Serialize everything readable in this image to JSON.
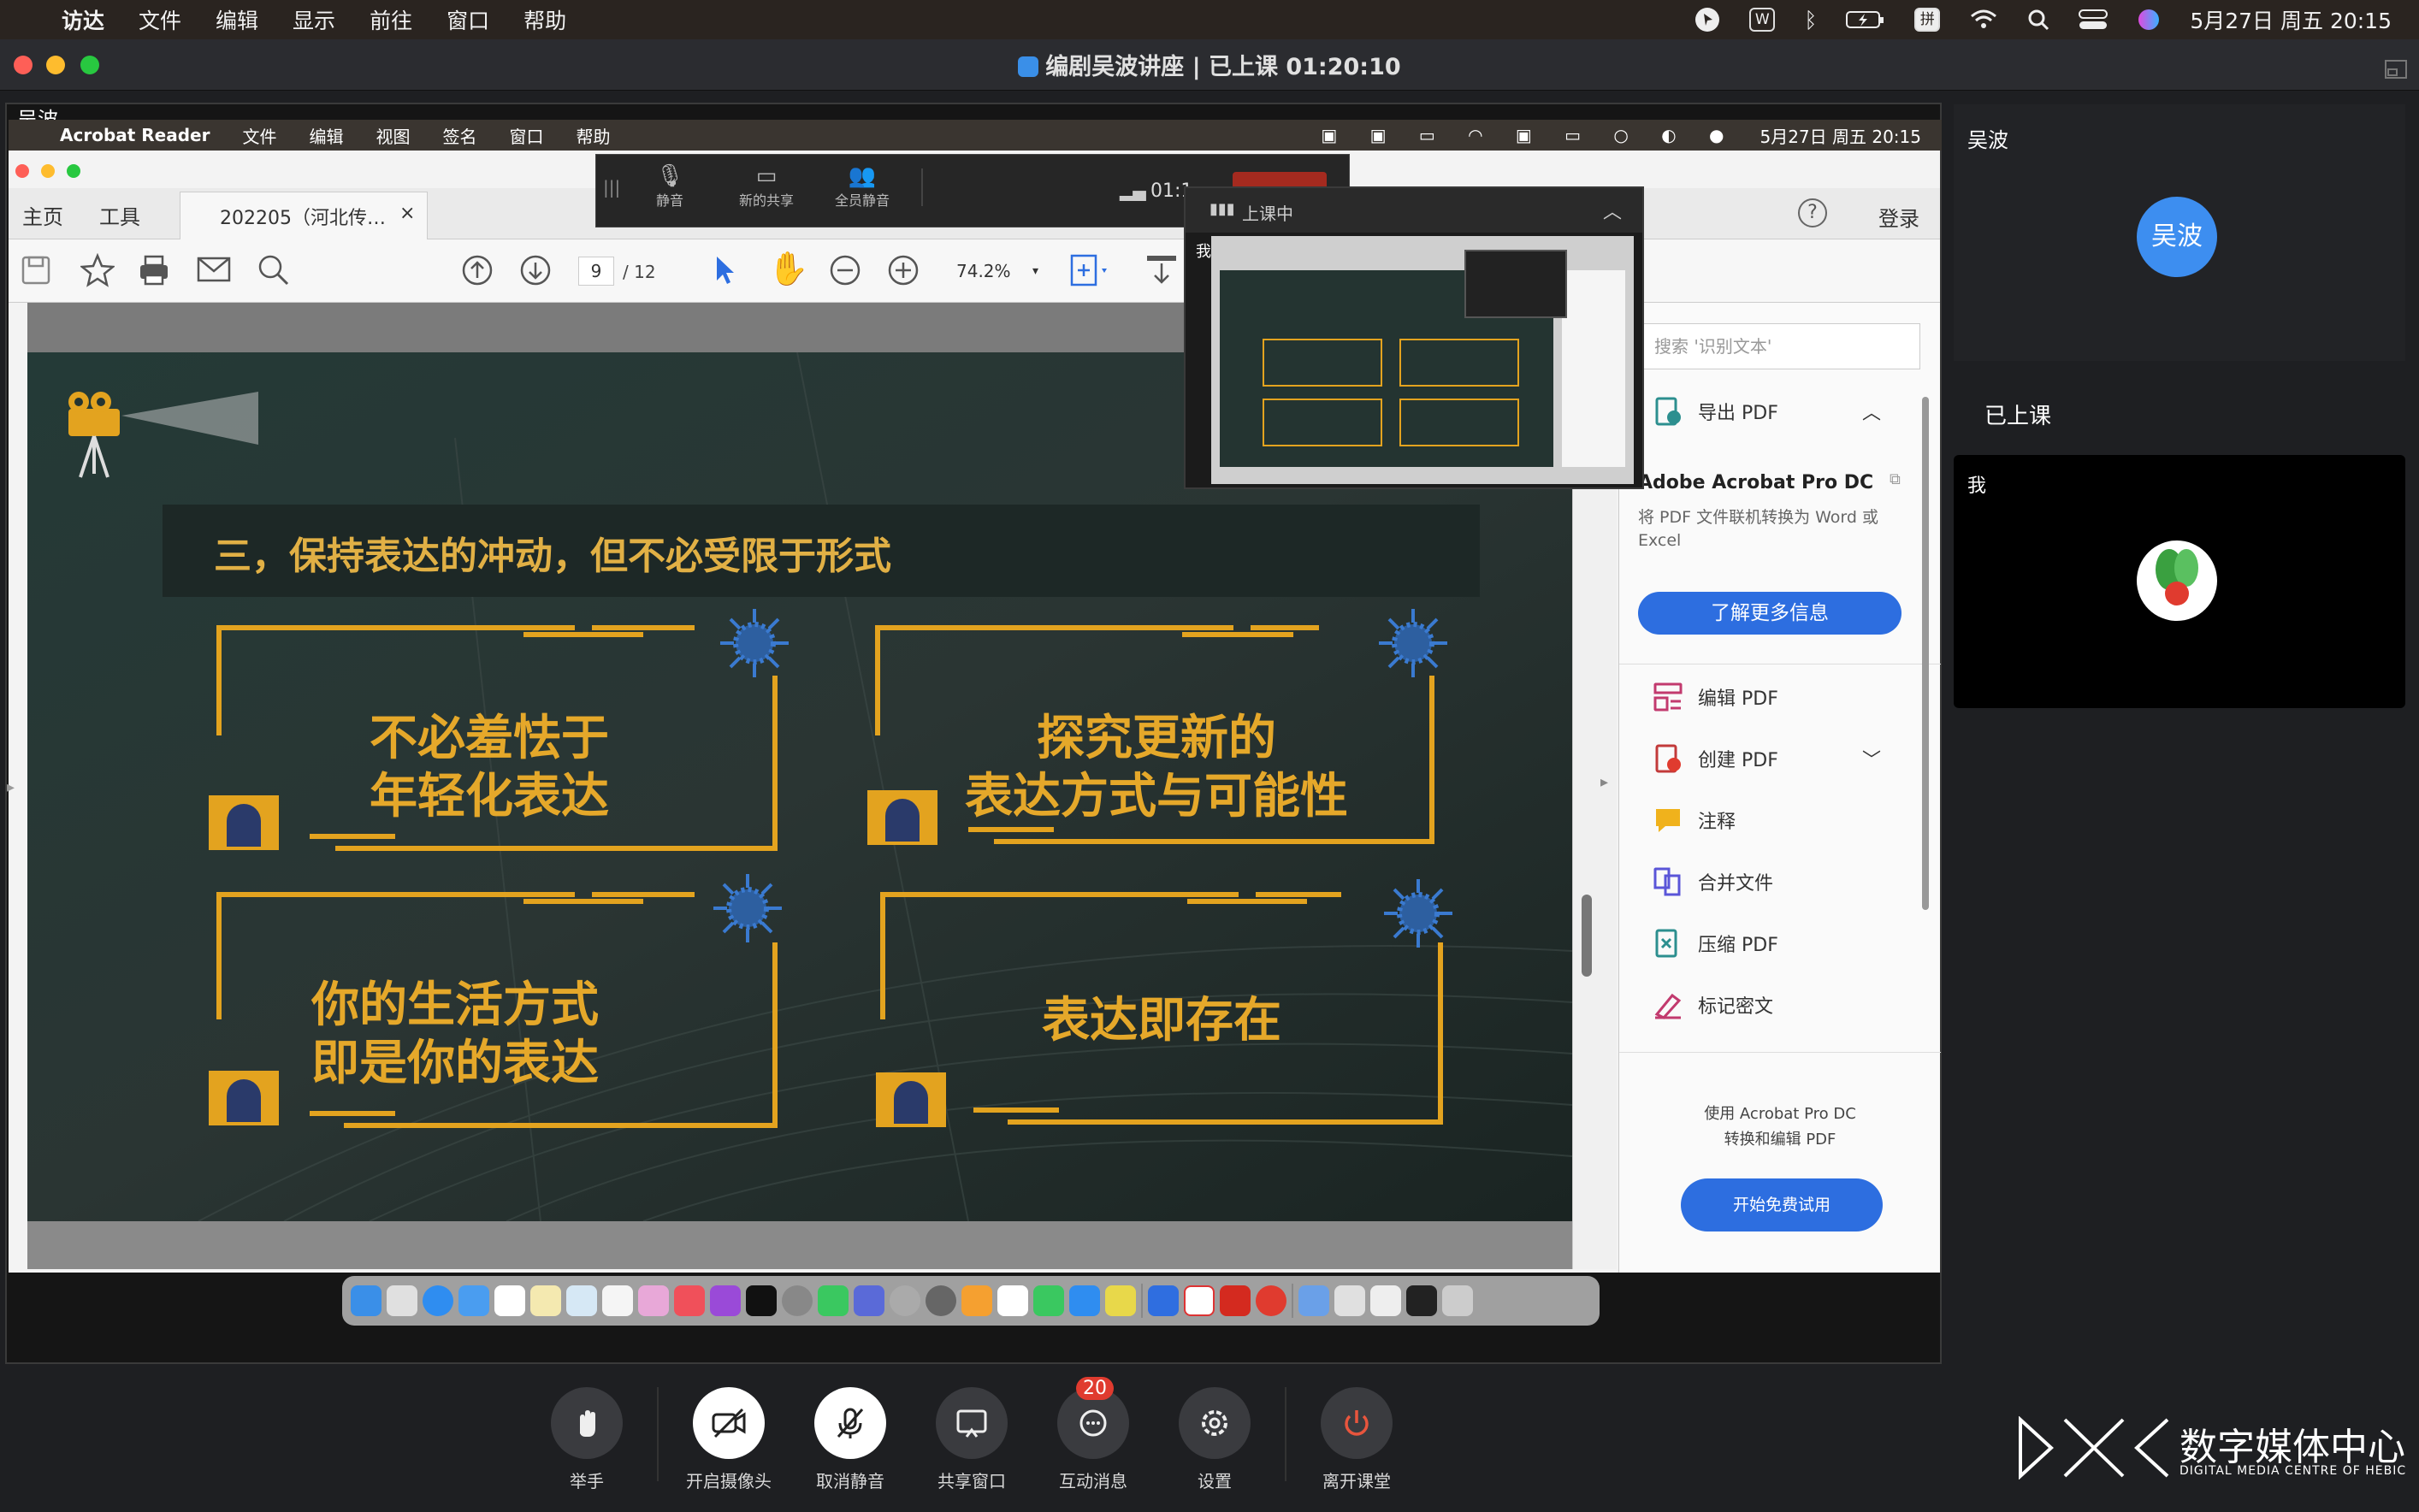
{
  "host_menubar": {
    "app": "访达",
    "items": [
      "文件",
      "编辑",
      "显示",
      "前往",
      "窗口",
      "帮助"
    ],
    "tray_icons": [
      "wps-icon",
      "bluetooth-icon",
      "battery-icon",
      "input-method-icon",
      "wifi-icon",
      "search-icon",
      "control-center-icon",
      "siri-icon"
    ],
    "input_method": "拼",
    "datetime": "5月27日 周五 20:15"
  },
  "window": {
    "title": "编剧吴波讲座 | 已上课 01:20:10"
  },
  "presenter_label": "吴波",
  "shared_screen": {
    "menubar": {
      "app": "Acrobat Reader",
      "items": [
        "文件",
        "编辑",
        "视图",
        "签名",
        "窗口",
        "帮助"
      ],
      "datetime": "5月27日 周五  20:15"
    },
    "acrobat": {
      "tabs": [
        "主页",
        "工具"
      ],
      "doc_tab": "202205（河北传…",
      "doc_tab_close": "×",
      "help": "?",
      "login": "登录",
      "page_current": "9",
      "page_total": "/ 12",
      "zoom": "74.2%",
      "search_placeholder": "搜索 '识别文本'",
      "export_pdf": "导出 PDF",
      "promo_title": "Adobe Acrobat Pro DC",
      "promo_desc": "将 PDF 文件联机转换为 Word 或 Excel",
      "learn_more": "了解更多信息",
      "tools": [
        "编辑 PDF",
        "创建 PDF",
        "注释",
        "合并文件",
        "压缩 PDF",
        "标记密文"
      ],
      "footer_line1": "使用 Acrobat Pro DC",
      "footer_line2": "转换和编辑 PDF",
      "trial_button": "开始免费试用"
    },
    "slide": {
      "title": "三，保持表达的冲动，但不必受限于形式",
      "boxes": [
        {
          "line1": "不必羞怯于",
          "line2": "年轻化表达"
        },
        {
          "line1": "探究更新的",
          "line2": "表达方式与可能性"
        },
        {
          "line1": "你的生活方式",
          "line2": "即是你的表达"
        },
        {
          "line1": "表达即存在",
          "line2": ""
        }
      ]
    },
    "meeting_toolbar": {
      "mute": "静音",
      "new_share": "新的共享",
      "mute_all": "全员静音",
      "timer": "01:1",
      "thumb_label": "上课中",
      "me_short": "我"
    }
  },
  "side_panel": {
    "teacher_name": "吴波",
    "teacher_avatar": "吴波",
    "section_label": "已上课",
    "me_label": "我"
  },
  "bottom_controls": [
    {
      "label": "举手",
      "icon": "raise-hand-icon"
    },
    {
      "label": "开启摄像头",
      "icon": "camera-off-icon"
    },
    {
      "label": "取消静音",
      "icon": "mic-off-icon"
    },
    {
      "label": "共享窗口",
      "icon": "share-screen-icon"
    },
    {
      "label": "互动消息",
      "icon": "chat-icon",
      "badge": "20"
    },
    {
      "label": "设置",
      "icon": "gear-icon"
    },
    {
      "label": "离开课堂",
      "icon": "power-icon"
    }
  ],
  "watermark": {
    "title": "数字媒体中心",
    "subtitle": "DIGITAL MEDIA CENTRE OF HEBIC"
  },
  "colors": {
    "slide_accent": "#e3a31f",
    "acrobat_blue": "#2d6ee0",
    "leave_red": "#e8553d",
    "badge_red": "#e03b2f"
  }
}
